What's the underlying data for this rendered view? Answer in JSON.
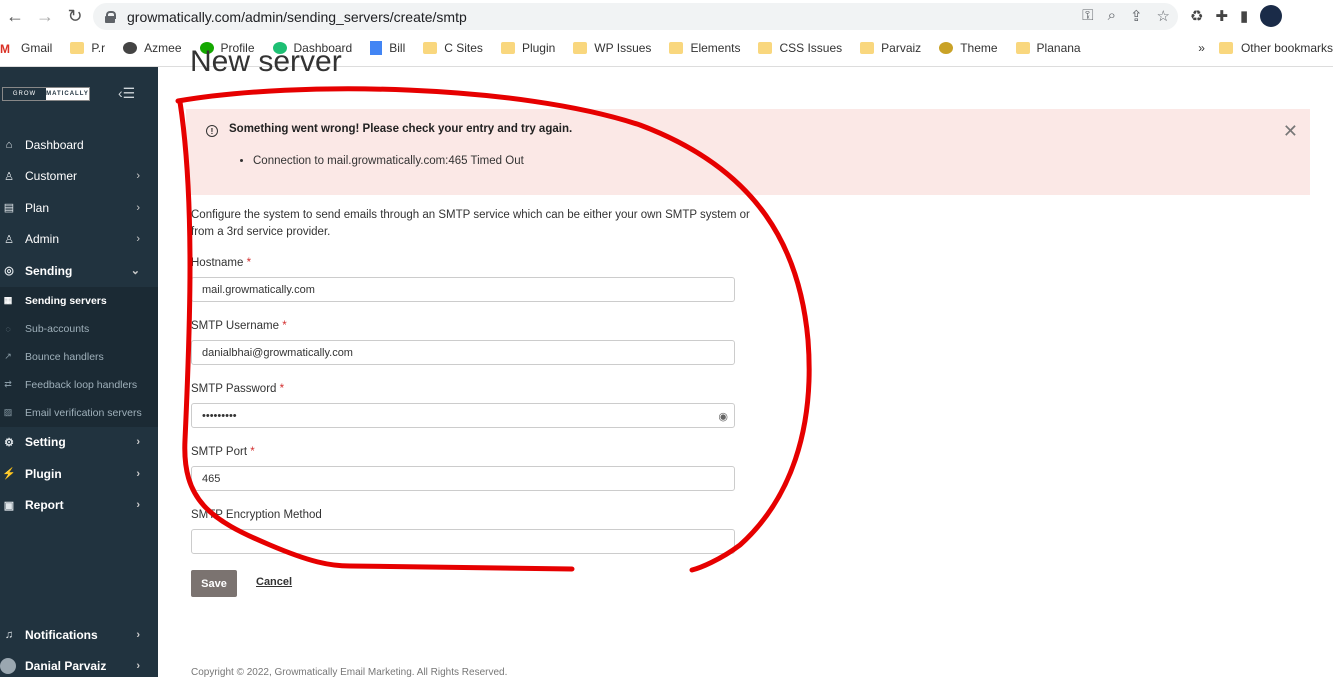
{
  "browser": {
    "url": "growmatically.com/admin/sending_servers/create/smtp",
    "bookmarks": [
      "Gmail",
      "P.r",
      "Azmee",
      "Profile",
      "Dashboard",
      "Bill",
      "C Sites",
      "Plugin",
      "WP Issues",
      "Elements",
      "CSS Issues",
      "Parvaiz",
      "Theme",
      "Planana"
    ],
    "overflow": "»",
    "other_bookmarks": "Other bookmarks"
  },
  "sidebar": {
    "logo_left": "GROW",
    "logo_right": "MATICALLY",
    "items": [
      {
        "label": "Dashboard",
        "icon": "home-icon"
      },
      {
        "label": "Customer",
        "icon": "user-icon"
      },
      {
        "label": "Plan",
        "icon": "plan-icon"
      },
      {
        "label": "Admin",
        "icon": "admin-icon"
      },
      {
        "label": "Sending",
        "icon": "sending-icon"
      }
    ],
    "sub_items": [
      {
        "label": "Sending servers",
        "icon": "server-icon"
      },
      {
        "label": "Sub-accounts",
        "icon": "sub-account-icon"
      },
      {
        "label": "Bounce handlers",
        "icon": "bounce-icon"
      },
      {
        "label": "Feedback loop handlers",
        "icon": "feedback-icon"
      },
      {
        "label": "Email verification servers",
        "icon": "verify-icon"
      }
    ],
    "items_after": [
      {
        "label": "Setting",
        "icon": "gear-icon"
      },
      {
        "label": "Plugin",
        "icon": "plugin-icon"
      },
      {
        "label": "Report",
        "icon": "report-icon"
      }
    ],
    "notifications": "Notifications",
    "user_name": "Danial Parvaiz"
  },
  "main": {
    "page_title": "New server",
    "alert": {
      "title": "Something went wrong! Please check your entry and try again.",
      "errors": [
        "Connection to mail.growmatically.com:465 Timed Out"
      ]
    },
    "description": "Configure the system to send emails through an SMTP service which can be either your own SMTP system or from a 3rd service provider.",
    "fields": {
      "hostname": {
        "label": "Hostname",
        "value": "mail.growmatically.com"
      },
      "username": {
        "label": "SMTP Username",
        "value": "danialbhai@growmatically.com"
      },
      "password": {
        "label": "SMTP Password",
        "value": "•••••••••"
      },
      "port": {
        "label": "SMTP Port",
        "value": "465"
      },
      "encryption": {
        "label": "SMTP Encryption Method",
        "value": ""
      }
    },
    "required_mark": "*",
    "save_label": "Save",
    "cancel_label": "Cancel",
    "footer": "Copyright © 2022, Growmatically Email Marketing. All Rights Reserved."
  },
  "colors": {
    "sidebar_bg": "#21333f",
    "alert_bg": "#fbe8e6",
    "required": "#d32f2f",
    "annotation": "#e60000",
    "save_bg": "#7b7370"
  }
}
